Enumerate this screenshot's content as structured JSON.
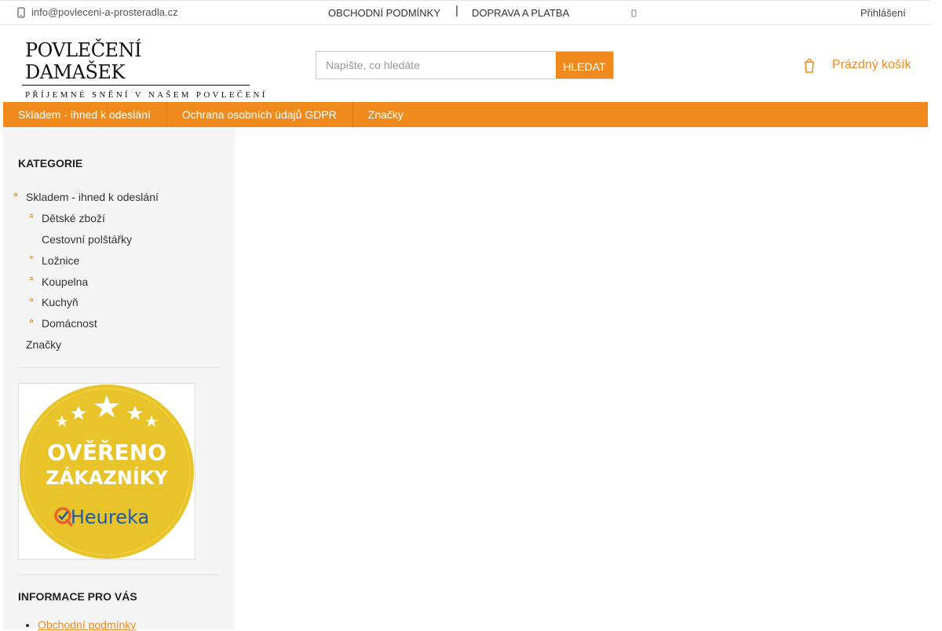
{
  "topbar": {
    "email": "info@povleceni-a-prosteradla.cz",
    "links": [
      "OBCHODNÍ PODMÍNKY",
      "DOPRAVA A PLATBA"
    ],
    "separator": "|",
    "login": "Přihlášení"
  },
  "header": {
    "logo_line1": "POVLEČENÍ DAMAŠEK",
    "logo_line2": "PŘÍJEMNÉ SNĚNÍ V NAŠEM POVLEČENÍ",
    "search_placeholder": "Napište, co hledáte",
    "search_button": "HLEDAT",
    "cart_label": "Prázdný košík"
  },
  "nav": [
    "Skladem - ihned k odeslání",
    "Ochrana osobních údajů GDPR",
    "Značky"
  ],
  "sidebar": {
    "categories_title": "KATEGORIE",
    "categories": [
      {
        "label": "Skladem - ihned k odeslání",
        "level": 0,
        "bullet": true
      },
      {
        "label": "Dětské zboží",
        "level": 1,
        "bullet": true
      },
      {
        "label": "Cestovní polštářky",
        "level": 1,
        "bullet": false
      },
      {
        "label": "Ložnice",
        "level": 1,
        "bullet": true
      },
      {
        "label": "Koupelna",
        "level": 1,
        "bullet": true
      },
      {
        "label": "Kuchyň",
        "level": 1,
        "bullet": true
      },
      {
        "label": "Domácnost",
        "level": 1,
        "bullet": true
      },
      {
        "label": "Značky",
        "level": 0,
        "bullet": false
      }
    ],
    "badge": {
      "line1": "OVĚŘENO",
      "line2": "ZÁKAZNÍKY",
      "brand": "Heureka"
    },
    "info_title": "INFORMACE PRO VÁS",
    "info_links": [
      "Obchodní podmínky"
    ]
  },
  "colors": {
    "accent": "#f08a1c",
    "sidebar_bg": "#f5f5f5",
    "badge_gold": "#e8c32a"
  }
}
